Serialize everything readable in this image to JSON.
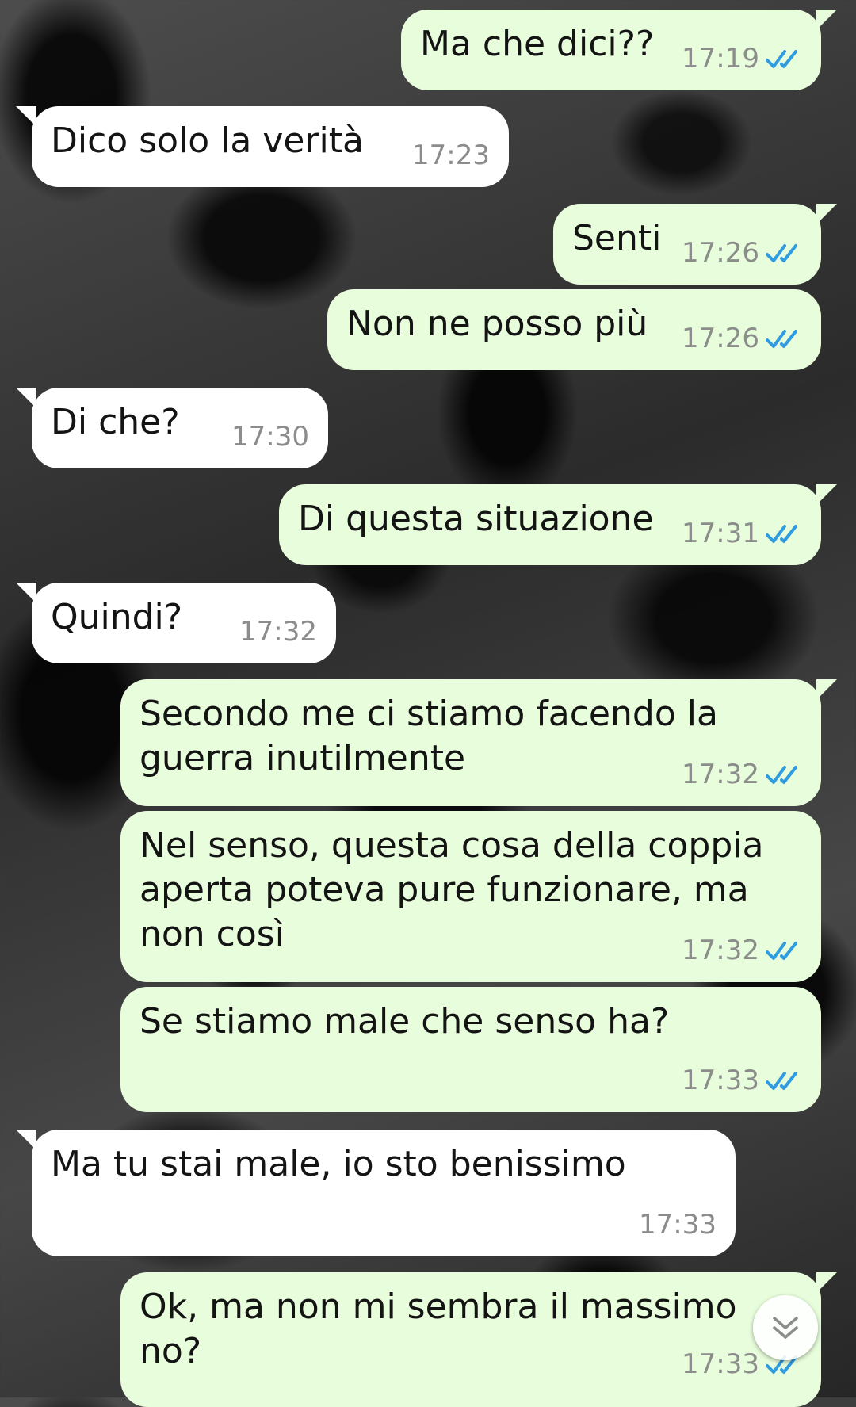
{
  "messages": [
    {
      "direction": "out",
      "text": "Ma che dici??",
      "time": "17:19",
      "read": true
    },
    {
      "direction": "in",
      "text": "Dico solo la verità",
      "time": "17:23"
    },
    {
      "direction": "out",
      "text": "Senti",
      "time": "17:26",
      "read": true
    },
    {
      "direction": "out",
      "text": "Non ne posso più",
      "time": "17:26",
      "read": true
    },
    {
      "direction": "in",
      "text": "Di che?",
      "time": "17:30"
    },
    {
      "direction": "out",
      "text": "Di questa situazione",
      "time": "17:31",
      "read": true
    },
    {
      "direction": "in",
      "text": "Quindi?",
      "time": "17:32"
    },
    {
      "direction": "out",
      "text": "Secondo me ci stiamo facendo la guerra inutilmente",
      "time": "17:32",
      "read": true
    },
    {
      "direction": "out",
      "text": "Nel senso, questa cosa della coppia aperta poteva pure funzionare, ma non così",
      "time": "17:32",
      "read": true
    },
    {
      "direction": "out",
      "text": "Se stiamo male che senso ha?",
      "time": "17:33",
      "read": true
    },
    {
      "direction": "in",
      "text": "Ma tu stai male, io sto benissimo",
      "time": "17:33"
    },
    {
      "direction": "out",
      "text": "Ok, ma non mi sembra il massimo no?",
      "time": "17:33",
      "read": true
    }
  ],
  "colors": {
    "outgoing_bubble": "#e7fddb",
    "incoming_bubble": "#ffffff",
    "read_ticks": "#2f9be0",
    "timestamp": "#8a8d8a"
  },
  "icons": {
    "read_receipt": "double-check-icon",
    "scroll_down": "chevron-down-icon"
  }
}
